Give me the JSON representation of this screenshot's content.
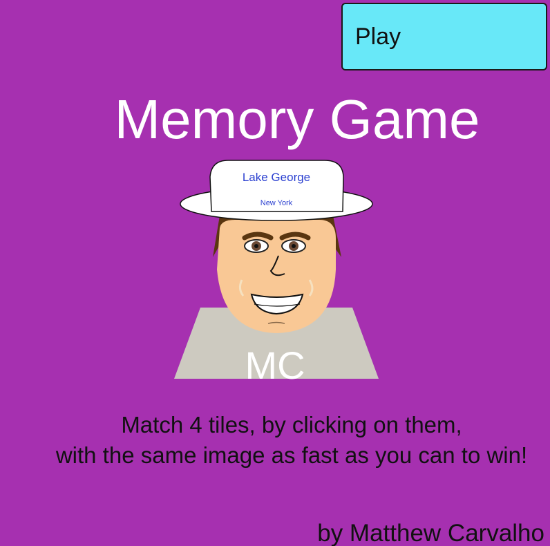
{
  "play_button": {
    "label": "Play"
  },
  "title": "Memory Game",
  "avatar": {
    "hat_line1": "Lake George",
    "hat_line2": "New York",
    "shirt_text": "MC"
  },
  "instructions": {
    "line1": "Match 4 tiles, by clicking on them,",
    "line2": "with the same image as fast as you can to win!"
  },
  "credit": "by Matthew Carvalho",
  "colors": {
    "background": "#a630b0",
    "play_button": "#68e8f8",
    "title": "#ffffff",
    "hat_text": "#2a3fd0",
    "shirt": "#cdcac0",
    "skin": "#f9c895",
    "hair": "#5a3610"
  }
}
